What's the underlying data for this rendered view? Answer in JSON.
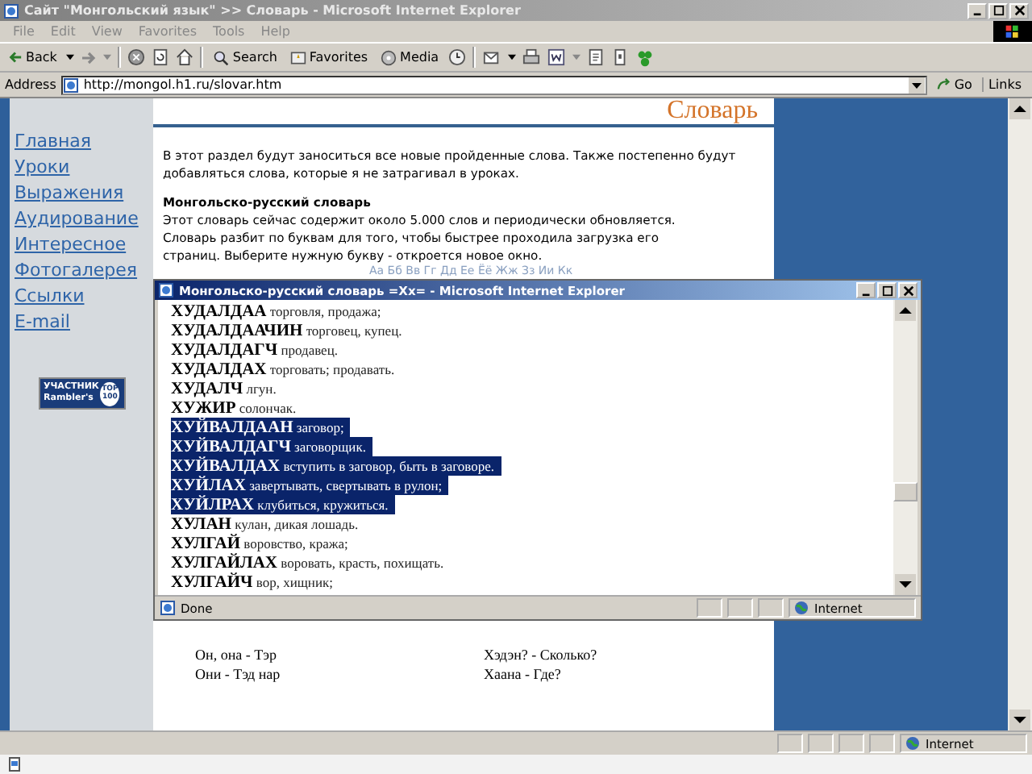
{
  "window": {
    "title": "Сайт \"Монгольский язык\" >> Словарь - Microsoft Internet Explorer"
  },
  "menu": [
    "File",
    "Edit",
    "View",
    "Favorites",
    "Tools",
    "Help"
  ],
  "toolbar": {
    "back": "Back",
    "search": "Search",
    "favorites": "Favorites",
    "media": "Media"
  },
  "address": {
    "label": "Address",
    "value": "http://mongol.h1.ru/slovar.htm",
    "go": "Go",
    "links": "Links"
  },
  "sidebar": {
    "links": [
      "Главная",
      "Уроки",
      "Выражения",
      "Аудирование",
      "Интересное",
      "Фотогалерея",
      "Ссылки",
      "E-mail"
    ],
    "badge": {
      "line1": "УЧАСТНИК",
      "line2": "Rambler's",
      "top": "TOP",
      "count": "100"
    }
  },
  "page": {
    "heading": "Словарь",
    "intro": "В этот раздел будут заноситься все новые пройденные слова. Также постепенно будут добавляться слова, которые я не затрагивал в уроках.",
    "section_title": "Монгольско-русский словарь",
    "section_text": "Этот словарь сейчас содержит около 5.000 слов и периодически обновляется. Словарь разбит по буквам для того, чтобы быстрее проходила загрузка его страниц. Выберите нужную букву - откроется новое окно.",
    "alphabet": "Аа Бб Вв Гг Дд Ее Ёё Жж Зз Ии Кк",
    "phrases": [
      {
        "left": "Он, она - Тэр",
        "right": "Хэдэн? - Сколько?"
      },
      {
        "left": "Они - Тэд нар",
        "right": "Хаана - Где?"
      }
    ]
  },
  "popup": {
    "title": "Монгольско-русский словарь =Хх= - Microsoft Internet Explorer",
    "entries": [
      {
        "term": "ХУДАЛДАА",
        "definition": "торговля, продажа;",
        "selected": false
      },
      {
        "term": "ХУДАЛДААЧИН",
        "definition": "торговец, купец.",
        "selected": false
      },
      {
        "term": "ХУДАЛДАГЧ",
        "definition": "продавец.",
        "selected": false
      },
      {
        "term": "ХУДАЛДАХ",
        "definition": "торговать; продавать.",
        "selected": false
      },
      {
        "term": "ХУДАЛЧ",
        "definition": "лгун.",
        "selected": false
      },
      {
        "term": "ХУЖИР",
        "definition": "солончак.",
        "selected": false
      },
      {
        "term": "ХУЙВАЛДААН",
        "definition": "заговор;",
        "selected": true
      },
      {
        "term": "ХУЙВАЛДАГЧ",
        "definition": "заговорщик.",
        "selected": true
      },
      {
        "term": "ХУЙВАЛДАХ",
        "definition": "вступить в заговор, быть в заговоре.",
        "selected": true
      },
      {
        "term": "ХУЙЛАХ",
        "definition": "завертывать, свертывать в рулон;",
        "selected": true
      },
      {
        "term": "ХУЙЛРАХ",
        "definition": "клубиться, кружиться.",
        "selected": true
      },
      {
        "term": "ХУЛАН",
        "definition": "кулан, дикая лошадь.",
        "selected": false
      },
      {
        "term": "ХУЛГАЙ",
        "definition": "воровство, кража;",
        "selected": false
      },
      {
        "term": "ХУЛГАЙЛАХ",
        "definition": "воровать, красть, похищать.",
        "selected": false
      },
      {
        "term": "ХУЛГАЙЧ",
        "definition": "вор, хищник;",
        "selected": false
      }
    ],
    "status": "Done",
    "zone": "Internet"
  },
  "status_bar": {
    "zone": "Internet"
  }
}
